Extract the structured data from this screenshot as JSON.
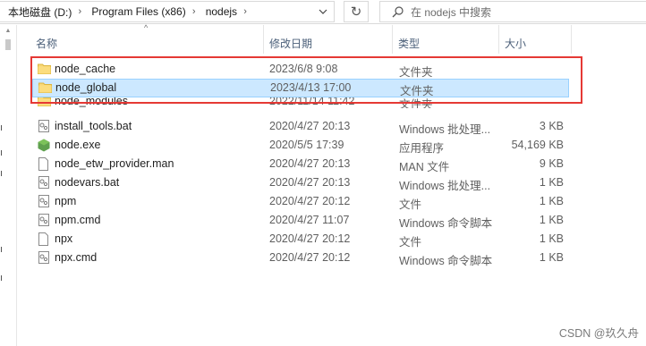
{
  "address": {
    "crumbs": [
      "本地磁盘 (D:)",
      "Program Files (x86)",
      "nodejs"
    ],
    "separator": "›",
    "dropdown_icon": "chevron-down-icon"
  },
  "refresh_icon": "↻",
  "search": {
    "placeholder": "在 nodejs 中搜索"
  },
  "columns": {
    "name": "名称",
    "date": "修改日期",
    "type": "类型",
    "size": "大小",
    "sort_icon": "^"
  },
  "files": [
    {
      "name": "node_cache",
      "date": "2023/6/8 9:08",
      "type": "文件夹",
      "size": "",
      "icon": "folder-icon"
    },
    {
      "name": "node_global",
      "date": "2023/4/13 17:00",
      "type": "文件夹",
      "size": "",
      "icon": "folder-icon",
      "selected": true
    },
    {
      "name": "node_modules",
      "date": "2022/11/14 11:42",
      "type": "文件夹",
      "size": "",
      "icon": "folder-icon"
    },
    {
      "name": "install_tools.bat",
      "date": "2020/4/27 20:13",
      "type": "Windows 批处理...",
      "size": "3 KB",
      "icon": "batch-file-icon"
    },
    {
      "name": "node.exe",
      "date": "2020/5/5 17:39",
      "type": "应用程序",
      "size": "54,169 KB",
      "icon": "node-app-icon"
    },
    {
      "name": "node_etw_provider.man",
      "date": "2020/4/27 20:13",
      "type": "MAN 文件",
      "size": "9 KB",
      "icon": "file-icon"
    },
    {
      "name": "nodevars.bat",
      "date": "2020/4/27 20:13",
      "type": "Windows 批处理...",
      "size": "1 KB",
      "icon": "batch-file-icon"
    },
    {
      "name": "npm",
      "date": "2020/4/27 20:12",
      "type": "文件",
      "size": "1 KB",
      "icon": "batch-file-icon"
    },
    {
      "name": "npm.cmd",
      "date": "2020/4/27 11:07",
      "type": "Windows 命令脚本",
      "size": "1 KB",
      "icon": "batch-file-icon"
    },
    {
      "name": "npx",
      "date": "2020/4/27 20:12",
      "type": "文件",
      "size": "1 KB",
      "icon": "file-icon"
    },
    {
      "name": "npx.cmd",
      "date": "2020/4/27 20:12",
      "type": "Windows 命令脚本",
      "size": "1 KB",
      "icon": "batch-file-icon"
    }
  ],
  "watermark": "CSDN @玖久舟",
  "colors": {
    "selection": "#cce8ff",
    "selection_border": "#99d1ff",
    "highlight_box": "#e53935",
    "folder": "#f8d775",
    "node_green": "#5fa04e"
  }
}
